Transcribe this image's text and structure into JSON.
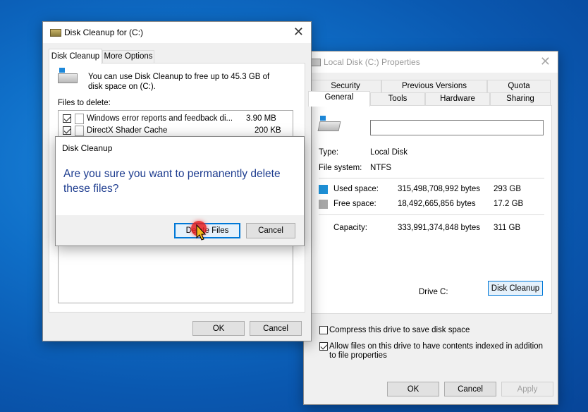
{
  "cleanup": {
    "title": "Disk Cleanup for  (C:)",
    "tabs": [
      "Disk Cleanup",
      "More Options"
    ],
    "info": "You can use Disk Cleanup to free up to 45.3 GB of disk space on  (C:).",
    "files_label": "Files to delete:",
    "files": [
      {
        "name": "Windows error reports and feedback di...",
        "size": "3.90 MB",
        "checked": true
      },
      {
        "name": "DirectX Shader Cache",
        "size": "200 KB",
        "checked": true
      }
    ],
    "ok": "OK",
    "cancel": "Cancel"
  },
  "confirm": {
    "title": "Disk Cleanup",
    "message": "Are you sure you want to permanently delete these files?",
    "delete": "Delete Files",
    "cancel": "Cancel"
  },
  "props": {
    "title": "Local Disk (C:) Properties",
    "tabs_row1": [
      "Security",
      "Previous Versions",
      "Quota"
    ],
    "tabs_row2": [
      "General",
      "Tools",
      "Hardware",
      "Sharing"
    ],
    "name_value": "",
    "type_label": "Type:",
    "type_value": "Local Disk",
    "fs_label": "File system:",
    "fs_value": "NTFS",
    "used_label": "Used space:",
    "used_bytes": "315,498,708,992 bytes",
    "used_gb": "293 GB",
    "free_label": "Free space:",
    "free_bytes": "18,492,665,856 bytes",
    "free_gb": "17.2 GB",
    "cap_label": "Capacity:",
    "cap_bytes": "333,991,374,848 bytes",
    "cap_gb": "311 GB",
    "drive_label": "Drive C:",
    "cleanup_btn": "Disk Cleanup",
    "compress": "Compress this drive to save disk space",
    "index": "Allow files on this drive to have contents indexed in addition to file properties",
    "ok": "OK",
    "cancel": "Cancel",
    "apply": "Apply",
    "colors": {
      "used": "#1e90d6",
      "free": "#a8a8a8"
    }
  }
}
